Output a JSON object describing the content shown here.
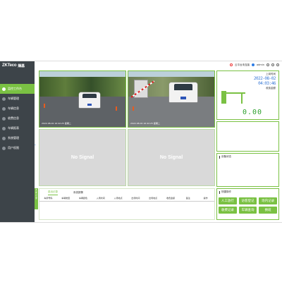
{
  "brand": {
    "logo_main": "ZKTeco",
    "logo_cn": "熵基"
  },
  "sidebar": {
    "items": [
      {
        "label": "监控工作台",
        "active": true
      },
      {
        "label": "车辆管理"
      },
      {
        "label": "车辆信息"
      },
      {
        "label": "收费信息"
      },
      {
        "label": "车辆报表"
      },
      {
        "label": "系统管理"
      },
      {
        "label": "用户权限"
      }
    ]
  },
  "topbar": {
    "message": "云平台未连接",
    "user": "admin",
    "icons": [
      "cloud-icon",
      "user-icon",
      "settings-icon",
      "minimize-icon",
      "close-icon"
    ]
  },
  "cameras": {
    "cam1": {
      "timestamp": "2022-08-02 16:42:25 星期二"
    },
    "cam2": {
      "timestamp": "2022-08-02 16:42:25 星期二"
    },
    "cam3": {
      "label": "No Signal"
    },
    "cam4": {
      "label": "No Signal"
    }
  },
  "panel_clock": {
    "label": "上岗时间",
    "date": "2022-08-02",
    "time": "04:03:46",
    "fee_label": "收费金额",
    "fee": "0.00"
  },
  "panel_device": {
    "title": "设备状态"
  },
  "panel_ops": {
    "title": "快捷操作",
    "buttons": [
      "人工放行",
      "访客登记",
      "场内记录",
      "收费记录",
      "车辆查询",
      "换班"
    ]
  },
  "records": {
    "side_tab": "关闭记录",
    "tabs": [
      "进出记录",
      "系统报警"
    ],
    "columns": [
      "车牌号码",
      "车辆类型",
      "车辆颜色",
      "入场时间",
      "入场地点",
      "出场时间",
      "出场地点",
      "收费金额",
      "备注",
      "操作"
    ]
  },
  "colors": {
    "accent": "#7ac143",
    "sidebar_bg": "#3d4449",
    "clock_blue": "#3b7bd6"
  }
}
